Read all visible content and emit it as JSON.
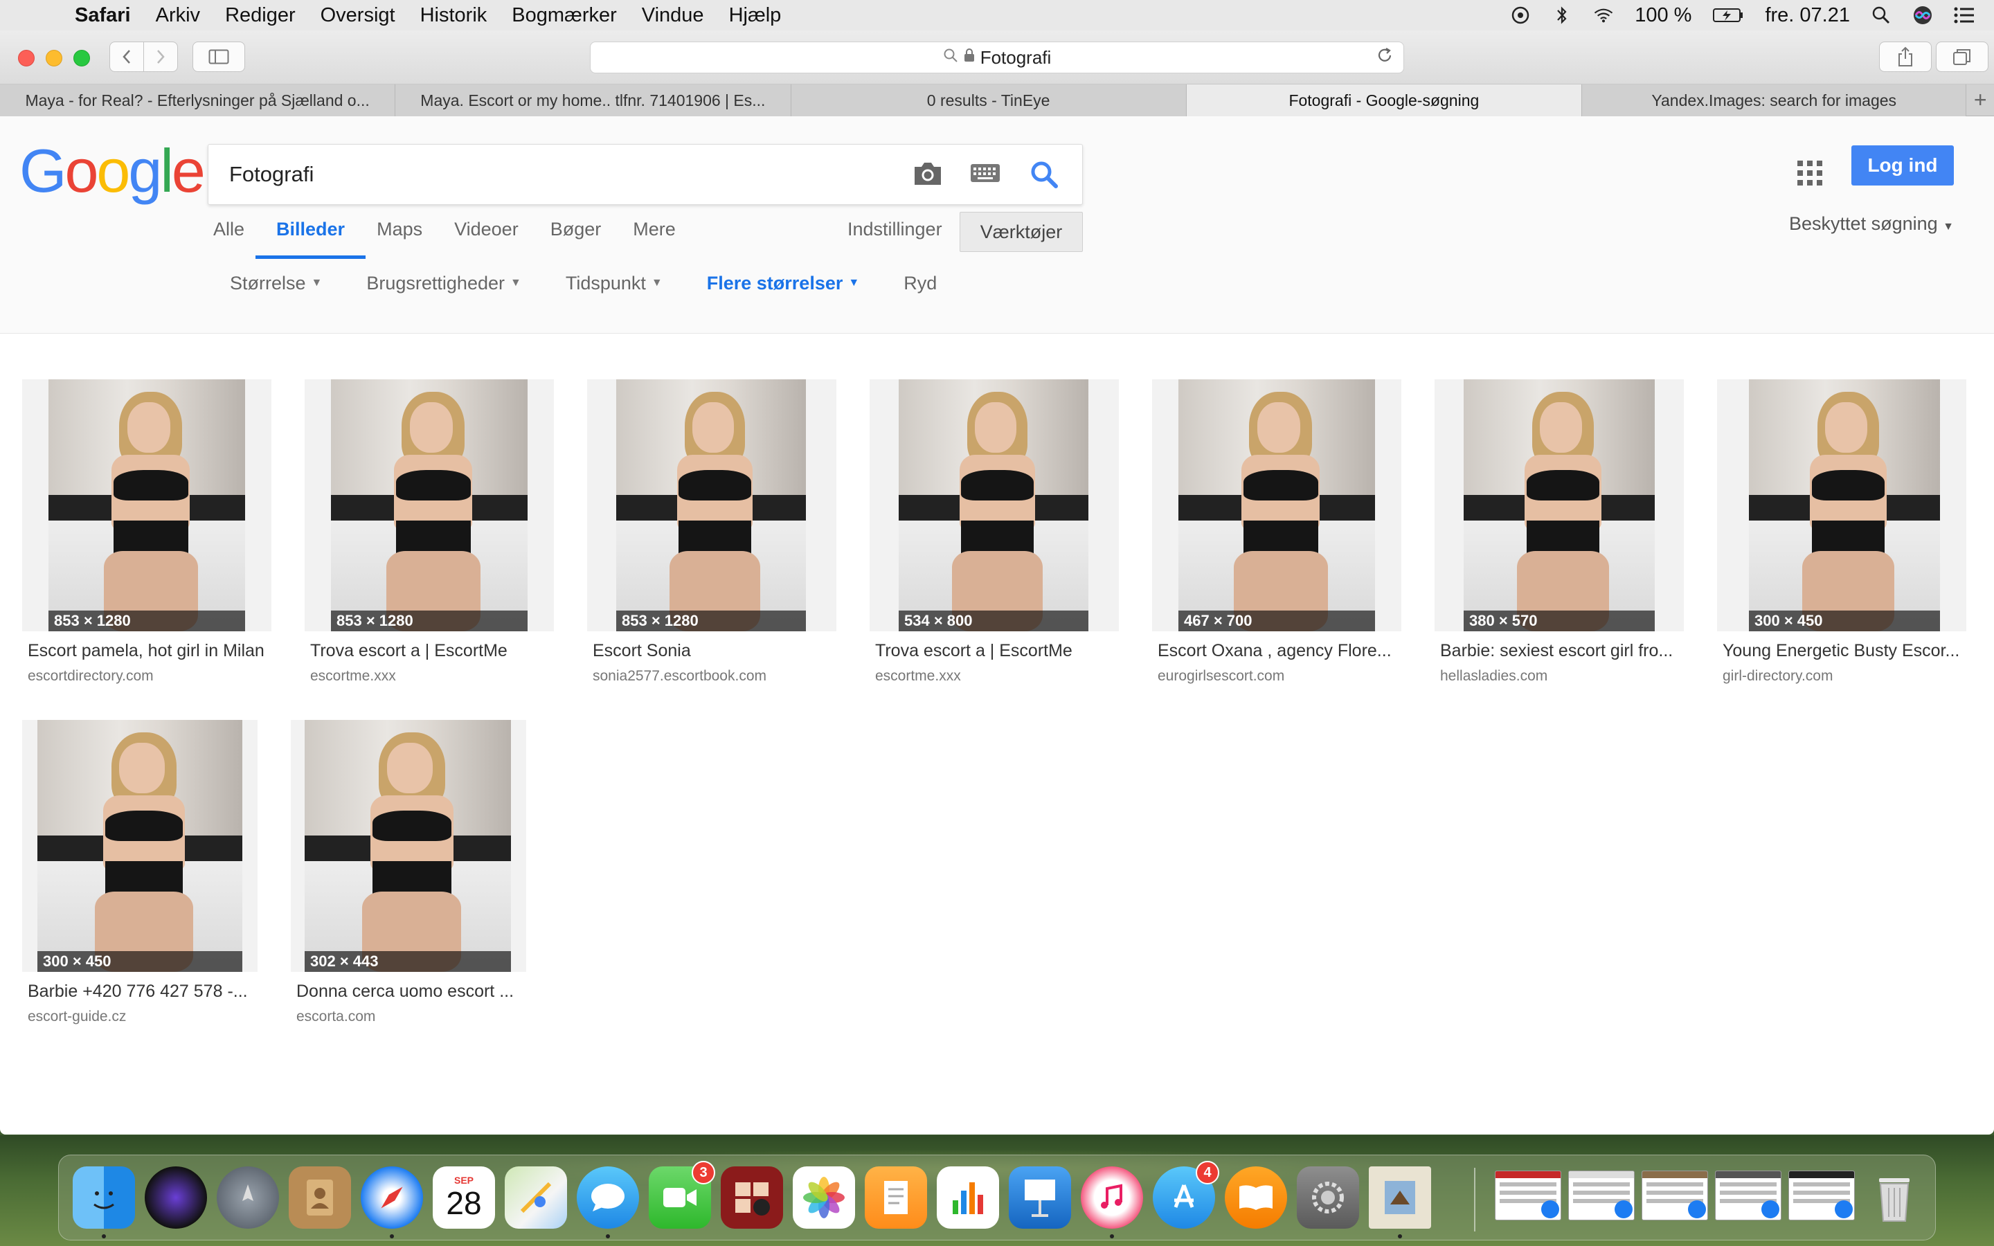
{
  "menubar": {
    "app_name": "Safari",
    "items": [
      "Arkiv",
      "Rediger",
      "Oversigt",
      "Historik",
      "Bogmærker",
      "Vindue",
      "Hjælp"
    ],
    "battery": "100 %",
    "clock": "fre. 07.21"
  },
  "browser": {
    "address": "Fotografi",
    "tabs": [
      {
        "label": "Maya - for Real? - Efterlysninger på Sjælland o...",
        "active": false
      },
      {
        "label": "Maya. Escort or my home.. tlfnr. 71401906 | Es...",
        "active": false
      },
      {
        "label": "0 results - TinEye",
        "active": false
      },
      {
        "label": "Fotografi - Google-søgning",
        "active": true
      },
      {
        "label": "Yandex.Images: search for images",
        "active": false
      }
    ]
  },
  "google": {
    "logo_letters": [
      "G",
      "o",
      "o",
      "g",
      "l",
      "e"
    ],
    "query": "Fotografi",
    "login_label": "Log ind",
    "tabs": [
      "Alle",
      "Billeder",
      "Maps",
      "Videoer",
      "Bøger",
      "Mere"
    ],
    "active_tab": "Billeder",
    "settings_label": "Indstillinger",
    "tools_label": "Værktøjer",
    "safesearch_label": "Beskyttet søgning",
    "filters": [
      "Størrelse",
      "Brugsrettigheder",
      "Tidspunkt",
      "Flere størrelser"
    ],
    "active_filter": "Flere størrelser",
    "clear_label": "Ryd"
  },
  "results": [
    {
      "size": "853 × 1280",
      "title": "Escort pamela, hot girl in Milan",
      "domain": "escortdirectory.com"
    },
    {
      "size": "853 × 1280",
      "title": "Trova escort a | EscortMe",
      "domain": "escortme.xxx"
    },
    {
      "size": "853 × 1280",
      "title": "Escort Sonia",
      "domain": "sonia2577.escortbook.com"
    },
    {
      "size": "534 × 800",
      "title": "Trova escort a | EscortMe",
      "domain": "escortme.xxx"
    },
    {
      "size": "467 × 700",
      "title": "Escort Oxana , agency Flore...",
      "domain": "eurogirlsescort.com"
    },
    {
      "size": "380 × 570",
      "title": "Barbie: sexiest escort girl fro...",
      "domain": "hellasladies.com"
    },
    {
      "size": "300 × 450",
      "title": "Young Energetic Busty Escor...",
      "domain": "girl-directory.com"
    },
    {
      "size": "300 × 450",
      "title": "Barbie +420 776 427 578 -...",
      "domain": "escort-guide.cz"
    },
    {
      "size": "302 × 443",
      "title": "Donna cerca uomo escort ...",
      "domain": "escorta.com"
    }
  ],
  "dock": {
    "calendar_month": "SEP",
    "calendar_day": "28",
    "facetime_badge": "3",
    "appstore_badge": "4"
  },
  "colors": {
    "google_blue": "#4285f4",
    "active_tab_blue": "#1a73e8",
    "badge_red": "#ec3b32"
  }
}
